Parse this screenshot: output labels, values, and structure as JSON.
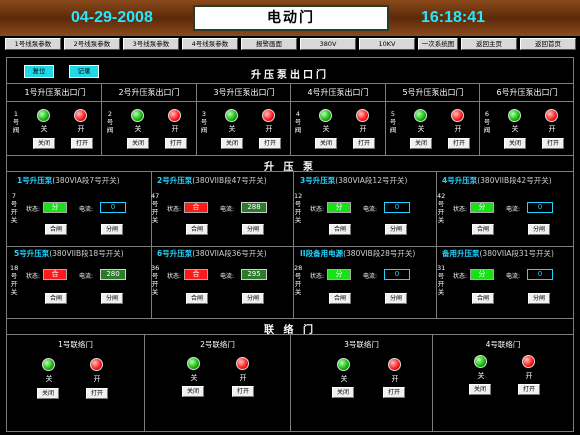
{
  "header": {
    "date": "04-29-2008",
    "title": "电动门",
    "time": "16:18:41"
  },
  "nav": [
    {
      "label": "1号线泵参数"
    },
    {
      "label": "2号线泵参数"
    },
    {
      "label": "3号线泵参数"
    },
    {
      "label": "4号线泵参数"
    },
    {
      "label": "报警画面"
    },
    {
      "label": "380V"
    },
    {
      "label": "10KV"
    },
    {
      "label": "一次系统图"
    },
    {
      "label": "返回主页"
    },
    {
      "label": "返回首页"
    }
  ],
  "controls": {
    "alarm": "复位",
    "record": "记录"
  },
  "outlet": {
    "title": "升压泵出口门",
    "groups": [
      {
        "title": "1号升压泵出口门",
        "label": "1号阀"
      },
      {
        "title": "2号升压泵出口门",
        "label": "2号阀"
      },
      {
        "title": "3号升压泵出口门",
        "label": "3号阀"
      },
      {
        "title": "4号升压泵出口门",
        "label": "4号阀"
      },
      {
        "title": "5号升压泵出口门",
        "label": "5号阀"
      },
      {
        "title": "6号升压泵出口门",
        "label": "6号阀"
      }
    ]
  },
  "common": {
    "close": "关",
    "open": "开",
    "close_btn": "关闭",
    "open_btn": "打开",
    "status": "状态:",
    "current": "电流:",
    "start_btn": "合闸",
    "stop_btn": "分闸"
  },
  "pumps": {
    "title": "升 压 泵",
    "items": [
      {
        "name": "1号升压泵",
        "bus": "(380VIA段7号开关)",
        "switch": "7号开关",
        "status": "分",
        "state": "green",
        "current": "0"
      },
      {
        "name": "2号升压泵",
        "bus": "(380VIIB段47号开关)",
        "switch": "47号开关",
        "status": "合",
        "state": "red",
        "current": "288"
      },
      {
        "name": "3号升压泵",
        "bus": "(380VIA段12号开关)",
        "switch": "12号开关",
        "status": "分",
        "state": "green",
        "current": "0"
      },
      {
        "name": "4号升压泵",
        "bus": "(380VIIB段42号开关)",
        "switch": "42号开关",
        "status": "分",
        "state": "green",
        "current": "0"
      },
      {
        "name": "5号升压泵",
        "bus": "(380VIIB段18号开关)",
        "switch": "18号开关",
        "status": "合",
        "state": "red",
        "current": "280"
      },
      {
        "name": "6号升压泵",
        "bus": "(380VIIA段36号开关)",
        "switch": "36号开关",
        "status": "合",
        "state": "red",
        "current": "295"
      },
      {
        "name": "II段备用电源",
        "bus": "(380VIB段28号开关)",
        "switch": "28号开关",
        "status": "分",
        "state": "green",
        "current": "0"
      },
      {
        "name": "备用升压泵",
        "bus": "(380VIIA段31号开关)",
        "switch": "31号开关",
        "status": "分",
        "state": "green",
        "current": "0"
      }
    ]
  },
  "liaison": {
    "title": "联 络 门",
    "gates": [
      {
        "title": "1号联络门"
      },
      {
        "title": "2号联络门"
      },
      {
        "title": "3号联络门"
      },
      {
        "title": "4号联络门"
      }
    ]
  },
  "colors": {
    "accent": "#23e8ff",
    "open_lamp": "#ff1515",
    "closed_lamp": "#0cb800",
    "header": "#7a3c14"
  }
}
